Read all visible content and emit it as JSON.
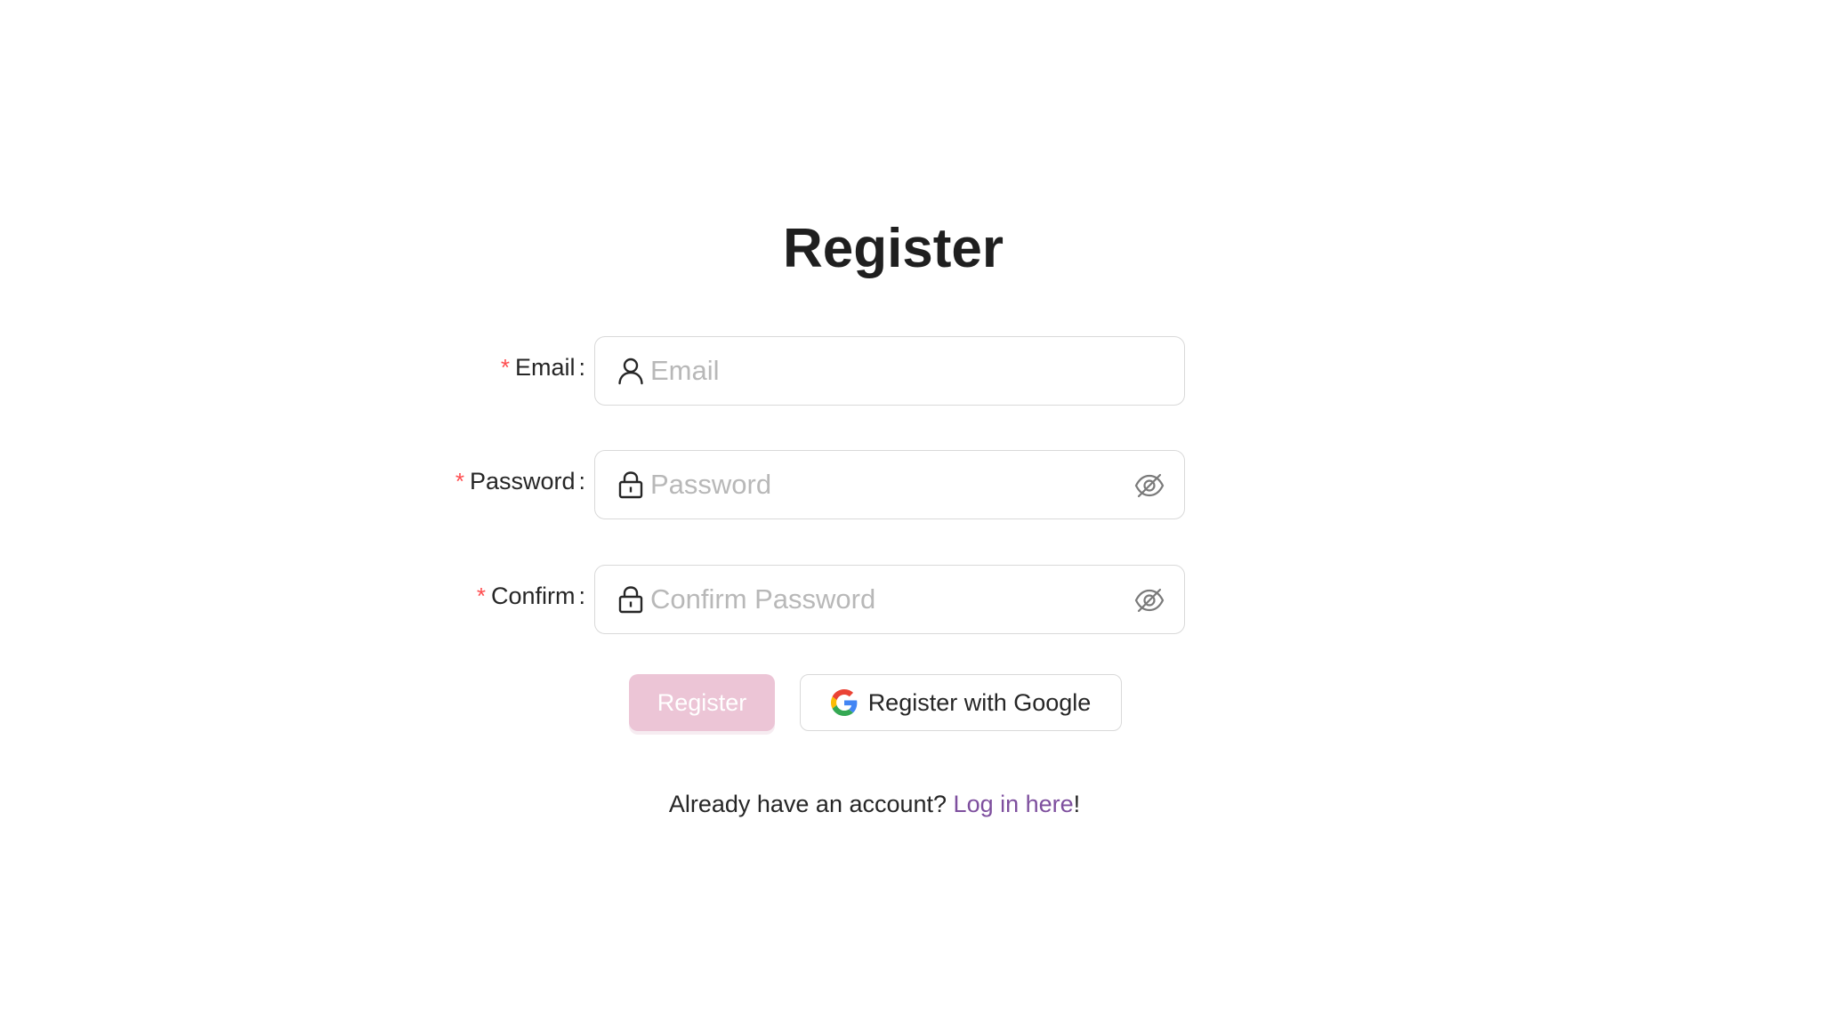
{
  "page": {
    "title": "Register"
  },
  "form": {
    "email": {
      "label": "Email",
      "required_mark": "*",
      "colon": ":",
      "placeholder": "Email",
      "value": "",
      "prefix_icon": "user-icon"
    },
    "password": {
      "label": "Password",
      "required_mark": "*",
      "colon": ":",
      "placeholder": "Password",
      "value": "",
      "prefix_icon": "lock-icon",
      "suffix_icon": "eye-invisible-icon"
    },
    "confirm": {
      "label": "Confirm",
      "required_mark": "*",
      "colon": ":",
      "placeholder": "Confirm Password",
      "value": "",
      "prefix_icon": "lock-icon",
      "suffix_icon": "eye-invisible-icon"
    }
  },
  "actions": {
    "register_label": "Register",
    "register_disabled": true,
    "google_label": "Register with Google",
    "google_icon": "google-logo-icon"
  },
  "footer": {
    "prompt": "Already have an account? ",
    "link_label": "Log in here",
    "suffix": "!"
  },
  "colors": {
    "required": "#ff4d4f",
    "register_button_bg": "#ecc5d6",
    "link": "#7e4f9e",
    "placeholder": "#b8b8b8",
    "border": "#d9d9d9"
  }
}
